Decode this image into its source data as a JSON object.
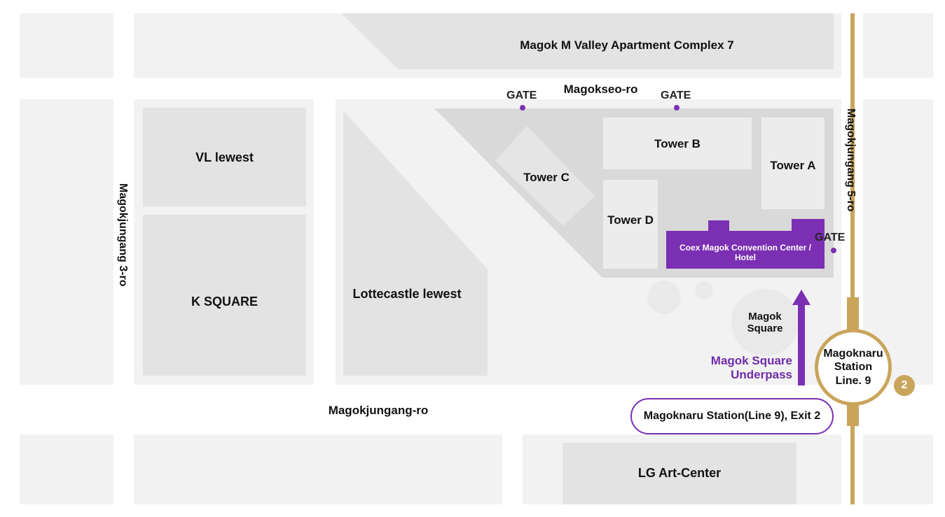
{
  "colors": {
    "block": "#f2f2f2",
    "campus": "#d9d9d9",
    "tower": "#ececec",
    "convention": "#7b2fb2",
    "metro_line": "#c9a55c",
    "accent_text": "#6f2da8"
  },
  "buildings": {
    "apartment": "Magok M Valley Apartment Complex 7",
    "vl_lewest": "VL lewest",
    "k_square": "K SQUARE",
    "lottecastle": "Lottecastle lewest",
    "tower_a": "Tower A",
    "tower_b": "Tower B",
    "tower_c": "Tower C",
    "tower_d": "Tower D",
    "convention_line1": "Coex Magok Convention Center /",
    "convention_line2": "Hotel",
    "magok_square_line1": "Magok",
    "magok_square_line2": "Square",
    "lg_art_center": "LG Art-Center"
  },
  "roads": {
    "magokseo": "Magokseo-ro",
    "magokjungang": "Magokjungang-ro",
    "magokjungang3": "Magokjungang 3-ro",
    "magokjungang5": "Magokjungang 5-ro"
  },
  "gates": [
    "GATE",
    "GATE",
    "GATE"
  ],
  "underpass": {
    "line1": "Magok Square",
    "line2": "Underpass"
  },
  "exit_label": "Magoknaru Station(Line 9), Exit 2",
  "station": {
    "line1": "Magoknaru",
    "line2": "Station",
    "line3": "Line. 9"
  },
  "exit_number": "2"
}
